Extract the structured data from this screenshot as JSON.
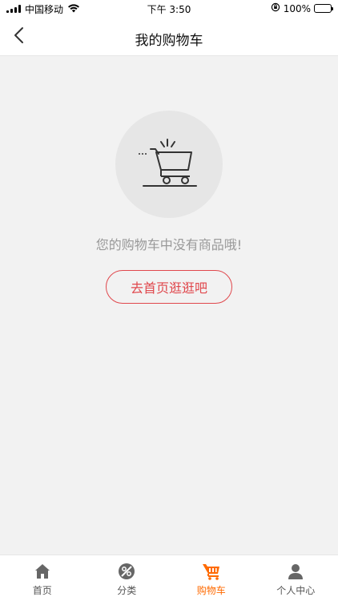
{
  "status_bar": {
    "carrier": "中国移动",
    "time": "下午 3:50",
    "battery": "100%"
  },
  "header": {
    "title": "我的购物车"
  },
  "empty_state": {
    "message": "您的购物车中没有商品哦!",
    "button_label": "去首页逛逛吧"
  },
  "tab_bar": {
    "tabs": [
      {
        "label": "首页",
        "icon": "home-icon"
      },
      {
        "label": "分类",
        "icon": "category-icon"
      },
      {
        "label": "购物车",
        "icon": "cart-icon",
        "active": true
      },
      {
        "label": "个人中心",
        "icon": "user-icon"
      }
    ]
  },
  "colors": {
    "accent": "#e0474c",
    "active_tab": "#ff6a00",
    "background": "#f2f2f2"
  }
}
